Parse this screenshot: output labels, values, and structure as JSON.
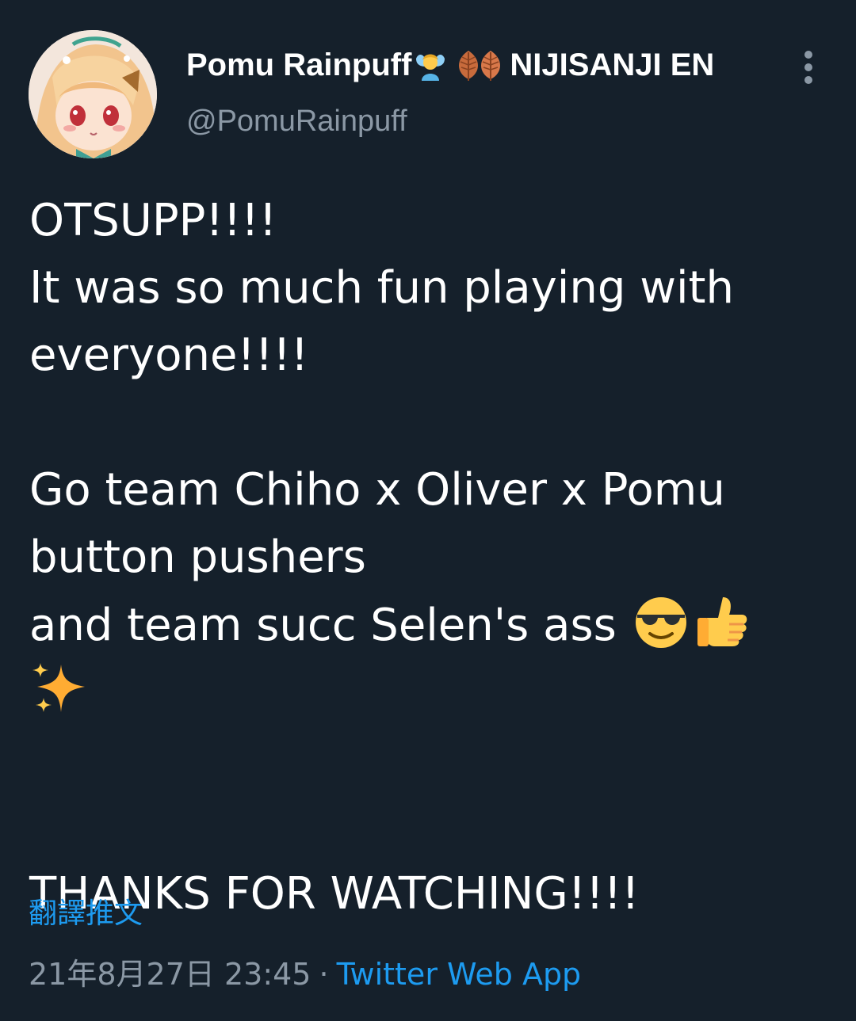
{
  "tweet": {
    "author": {
      "display_name_part1": "Pomu Rainpuff",
      "display_name_part2": "NIJISANJI EN",
      "name_emojis": [
        "fairy-emoji",
        "leaf-emoji",
        "leaf-emoji"
      ],
      "handle": "@PomuRainpuff"
    },
    "menu_icon": "more-vertical-icon",
    "body_lines": [
      "OTSUPP!!!!",
      "It was so much fun playing with",
      "everyone!!!!",
      "",
      "Go team Chiho x Oliver x Pomu",
      "button pushers",
      "and team succ Selen's ass ",
      "",
      "",
      "",
      "THANKS FOR WATCHING!!!!"
    ],
    "body_emojis": [
      "smiling-face-with-sunglasses-emoji",
      "thumbs-up-emoji",
      "sparkles-emoji"
    ],
    "translate_link": "翻譯推文",
    "timestamp": "21年8月27日 23:45",
    "separator": "·",
    "source": "Twitter Web App",
    "colors": {
      "background": "#15202b",
      "text": "#ffffff",
      "secondary": "#8b98a5",
      "link": "#1d9bf0"
    }
  }
}
